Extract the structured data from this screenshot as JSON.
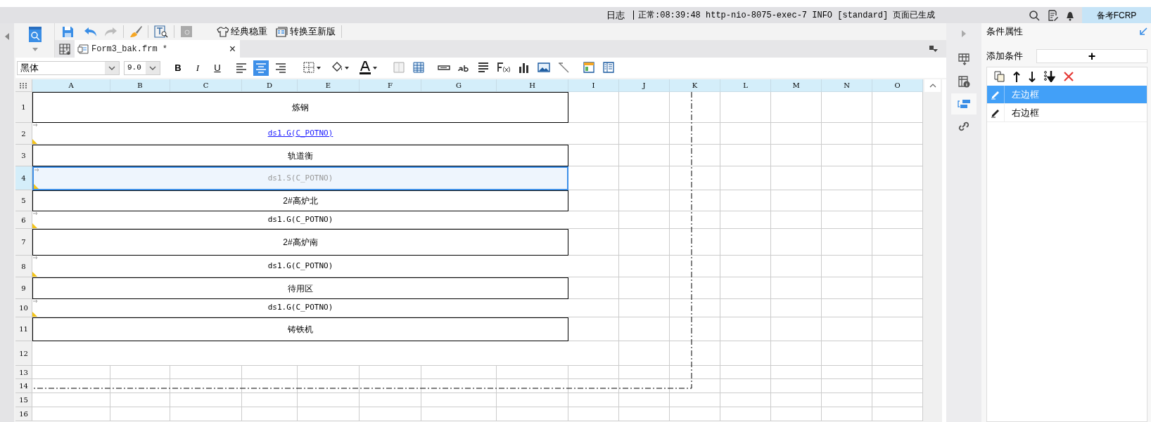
{
  "status_bar": {
    "log_label": "日志",
    "log_message": "正常:08:39:48 http-nio-8075-exec-7 INFO [standard] 页面已生成",
    "user_button": "备考FCRP"
  },
  "toolbar": {
    "buttons": [
      {
        "kind": "theme",
        "label": "经典稳重"
      },
      {
        "kind": "convert",
        "label": "转换至新版"
      }
    ]
  },
  "tabs": [
    {
      "label": "Form3_bak.frm *",
      "selected": true,
      "close": "×"
    }
  ],
  "format_toolbar": {
    "font": "黑体",
    "font_size": "9.0",
    "styles": [
      "B",
      "I",
      "U"
    ],
    "alignment": [
      {
        "kind": "left",
        "selected": false
      },
      {
        "kind": "center",
        "selected": true
      },
      {
        "kind": "right",
        "selected": false
      }
    ]
  },
  "sheet": {
    "columns": [
      "A",
      "B",
      "C",
      "D",
      "E",
      "F",
      "G",
      "H",
      "I",
      "J",
      "K",
      "L",
      "M",
      "N",
      "O"
    ],
    "row_numbers": [
      "1",
      "2",
      "3",
      "4",
      "5",
      "6",
      "7",
      "8",
      "9",
      "10",
      "11",
      "12",
      "13",
      "14",
      "15",
      "16"
    ],
    "rows": [
      {
        "kind": "title",
        "text": "炼钢",
        "selected": false
      },
      {
        "kind": "link",
        "text": "ds1.G(C_POTNO)",
        "selected": false
      },
      {
        "kind": "title",
        "text": "轨道衡",
        "selected": false
      },
      {
        "kind": "summary",
        "text": "ds1.S(C_POTNO)",
        "selected": true
      },
      {
        "kind": "title",
        "text": "2#高炉北",
        "selected": false
      },
      {
        "kind": "group",
        "text": "ds1.G(C_POTNO)",
        "selected": false
      },
      {
        "kind": "title",
        "text": "2#高炉南",
        "selected": false
      },
      {
        "kind": "group",
        "text": "ds1.G(C_POTNO)",
        "selected": false
      },
      {
        "kind": "title",
        "text": "待用区",
        "selected": false
      },
      {
        "kind": "group",
        "text": "ds1.G(C_POTNO)",
        "selected": false
      },
      {
        "kind": "title",
        "text": "铸铁机",
        "selected": false
      }
    ]
  },
  "side_tabs": [
    {
      "kind": "cell",
      "selected": false
    },
    {
      "kind": "info",
      "selected": false
    },
    {
      "kind": "condition",
      "selected": true
    },
    {
      "kind": "link",
      "selected": false
    }
  ],
  "panel": {
    "title": "条件属性",
    "add_label": "添加条件",
    "add_button": "+",
    "conditions": [
      {
        "label": "左边框",
        "selected": true
      },
      {
        "label": "右边框",
        "selected": false
      }
    ]
  }
}
